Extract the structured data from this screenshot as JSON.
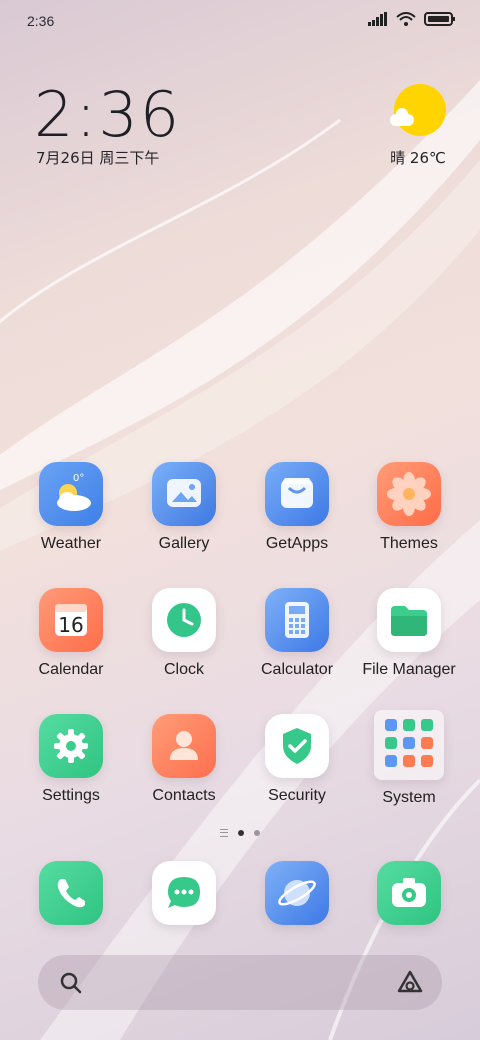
{
  "status_bar": {
    "time": "2:36"
  },
  "lockwidget": {
    "time": "2:36",
    "date": "7月26日 周三下午"
  },
  "weather_widget": {
    "text": "晴 26℃"
  },
  "apps_grid": [
    {
      "label": "Weather",
      "icon": "weather-icon"
    },
    {
      "label": "Gallery",
      "icon": "gallery-icon"
    },
    {
      "label": "GetApps",
      "icon": "getapps-icon"
    },
    {
      "label": "Themes",
      "icon": "themes-icon"
    },
    {
      "label": "Calendar",
      "icon": "calendar-icon",
      "badge": "16"
    },
    {
      "label": "Clock",
      "icon": "clock-icon"
    },
    {
      "label": "Calculator",
      "icon": "calculator-icon"
    },
    {
      "label": "File Manager",
      "icon": "file-manager-icon"
    },
    {
      "label": "Settings",
      "icon": "settings-icon"
    },
    {
      "label": "Contacts",
      "icon": "contacts-icon"
    },
    {
      "label": "Security",
      "icon": "security-icon"
    },
    {
      "label": "System",
      "icon": "system-folder-icon"
    }
  ],
  "weather_icon_temp": "0°",
  "dock": [
    "phone-icon",
    "messages-icon",
    "browser-icon",
    "camera-icon"
  ],
  "search": {
    "left_icon": "search-icon",
    "right_icon": "assistant-icon"
  },
  "colors": {
    "green": "#37d08c",
    "blue": "#4c8ff2",
    "orange": "#ff7c52",
    "sun": "#ffd400"
  }
}
